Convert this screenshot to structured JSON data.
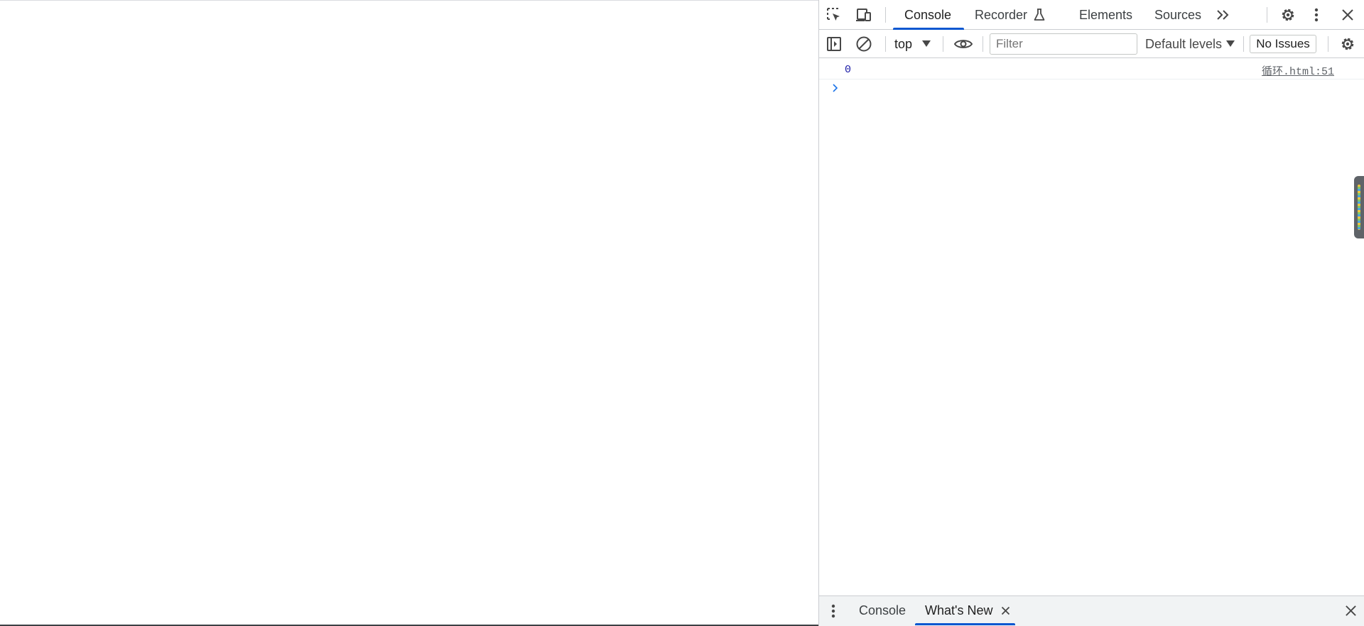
{
  "devtools": {
    "toolbar": {
      "tabs": [
        {
          "label": "Console",
          "active": true
        },
        {
          "label": "Recorder"
        },
        {
          "label": "Elements"
        },
        {
          "label": "Sources"
        }
      ],
      "more_tabs_icon": "chevrons-right-icon",
      "icons": [
        "inspect-element-icon",
        "device-toggle-icon",
        "settings-icon",
        "more-menu-icon",
        "close-icon",
        "flask-icon"
      ]
    },
    "console_toolbar": {
      "context": "top",
      "filter_placeholder": "Filter",
      "filter_value": "",
      "levels_label": "Default levels",
      "issues_label": "No Issues"
    },
    "messages": [
      {
        "value": "0",
        "source": "循环.html:51"
      }
    ],
    "drawer": {
      "tabs": [
        {
          "label": "Console"
        },
        {
          "label": "What's New",
          "active": true
        }
      ]
    },
    "colors": {
      "accent": "#0b57d0",
      "number_value": "#1a1aa6",
      "prompt": "#1a73e8"
    }
  }
}
